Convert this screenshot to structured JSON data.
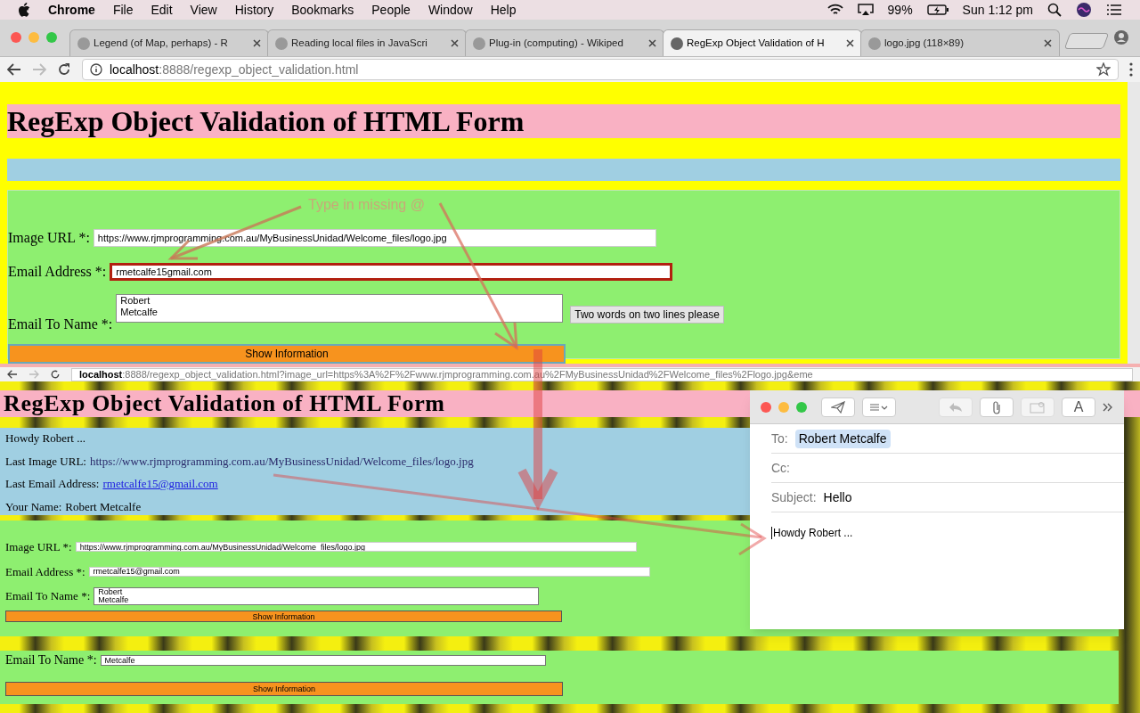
{
  "menu_bar": {
    "app": "Chrome",
    "menus": [
      "File",
      "Edit",
      "View",
      "History",
      "Bookmarks",
      "People",
      "Window",
      "Help"
    ],
    "battery": "99%",
    "clock": "Sun 1:12 pm"
  },
  "tabs": [
    {
      "title": "Legend (of Map, perhaps) - R",
      "selected": false
    },
    {
      "title": "Reading local files in JavaScri",
      "selected": false
    },
    {
      "title": "Plug-in (computing) - Wikiped",
      "selected": false
    },
    {
      "title": "RegExp Object Validation of H",
      "selected": true
    },
    {
      "title": "logo.jpg (118×89)",
      "selected": false
    }
  ],
  "address_bar": {
    "host": "localhost",
    "path": ":8888/regexp_object_validation.html"
  },
  "page": {
    "heading": "RegExp Object Validation of HTML Form",
    "annotation": "Type in missing @",
    "fields": [
      {
        "kind": "input",
        "label": "Image URL *:",
        "value": "https://www.rjmprogramming.com.au/MyBusinessUnidad/Welcome_files/logo.jpg",
        "invalid": false
      },
      {
        "kind": "input",
        "label": "Email Address *:",
        "value": "rmetcalfe15gmail.com",
        "invalid": true
      },
      {
        "kind": "textarea",
        "label": "Email To Name *:",
        "value": "Robert\nMetcalfe",
        "invalid": false,
        "hint": "Two words on two lines please"
      }
    ],
    "button": "Show Information"
  },
  "result_page": {
    "address": {
      "host": "localhost",
      "path": ":8888/regexp_object_validation.html?image_url=https%3A%2F%2Fwww.rjmprogramming.com.au%2FMyBusinessUnidad%2FWelcome_files%2Flogo.jpg&eme"
    },
    "heading": "RegExp Object Validation of HTML Form",
    "info": [
      {
        "kind": "text",
        "text": "Howdy Robert ..."
      },
      {
        "kind": "value",
        "label": "Last Image URL:",
        "value": "https://www.rjmprogramming.com.au/MyBusinessUnidad/Welcome_files/logo.jpg"
      },
      {
        "kind": "link",
        "label": "Last Email Address:",
        "value": "rmetcalfe15@gmail.com"
      },
      {
        "kind": "value",
        "label": "Your Name:",
        "value": "Robert Metcalfe"
      }
    ],
    "fields": [
      {
        "kind": "input",
        "label": "Image URL *:",
        "value": "https://www.rjmprogramming.com.au/MyBusinessUnidad/Welcome_files/logo.jpg"
      },
      {
        "kind": "input",
        "label": "Email Address *:",
        "value": "rmetcalfe15@gmail.com"
      },
      {
        "kind": "textarea",
        "label": "Email To Name *:",
        "value": "Robert\nMetcalfe"
      }
    ],
    "button": "Show Information",
    "lower_field": {
      "label": "Email To Name *:",
      "value": "Metcalfe"
    },
    "lower_button": "Show Information"
  },
  "mail": {
    "font_button": "A",
    "to_label": "To:",
    "to": "Robert Metcalfe",
    "cc_label": "Cc:",
    "subject_label": "Subject:",
    "subject": "Hello",
    "body": "Howdy Robert ..."
  }
}
